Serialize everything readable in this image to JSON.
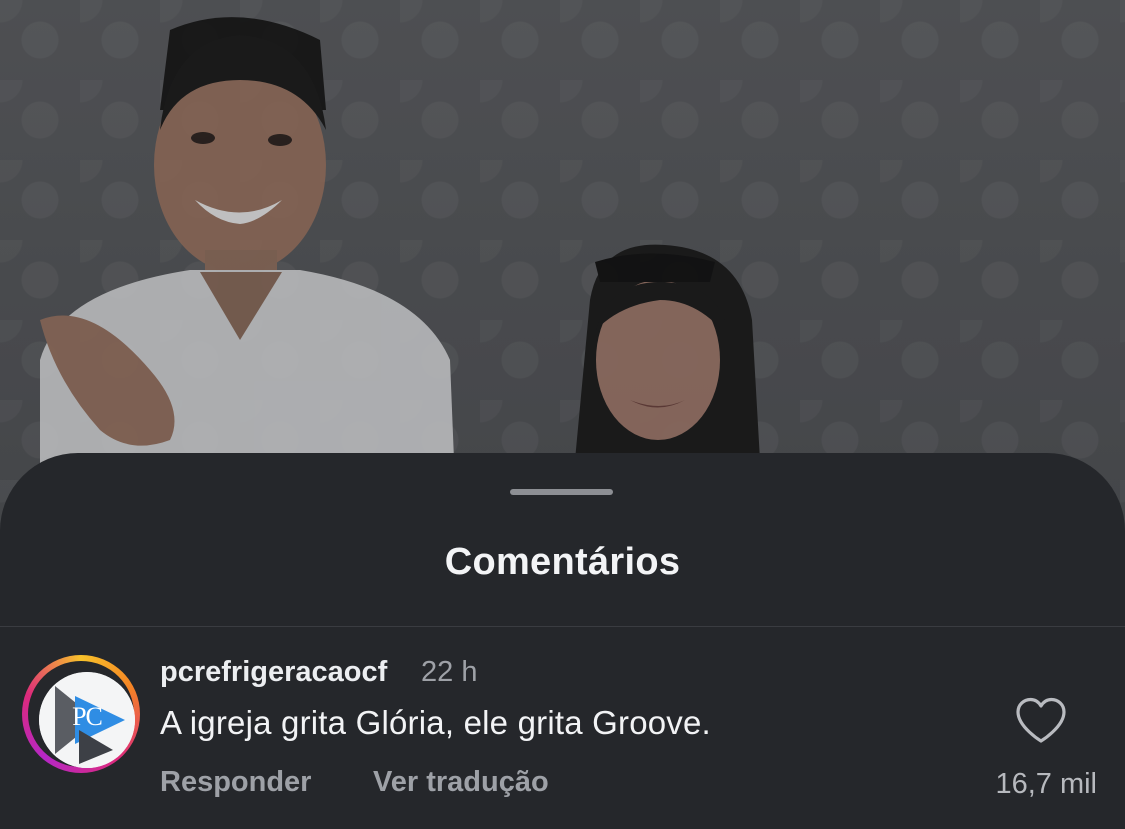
{
  "sheet": {
    "title": "Comentários"
  },
  "comment": {
    "avatar_text": "PC",
    "username": "pcrefrigeracaocf",
    "time": "22 h",
    "text": "A igreja grita Glória, ele grita Groove.",
    "reply_label": "Responder",
    "translate_label": "Ver tradução",
    "like_icon": "heart-outline-icon",
    "like_count": "16,7 mil"
  },
  "colors": {
    "sheet_bg": "#25272b",
    "primary_text": "#f2f3f5",
    "secondary_text": "#9ea1a7",
    "avatar_ring": [
      "#f8c22b",
      "#f58524",
      "#dd2a7b",
      "#b527c6"
    ]
  }
}
